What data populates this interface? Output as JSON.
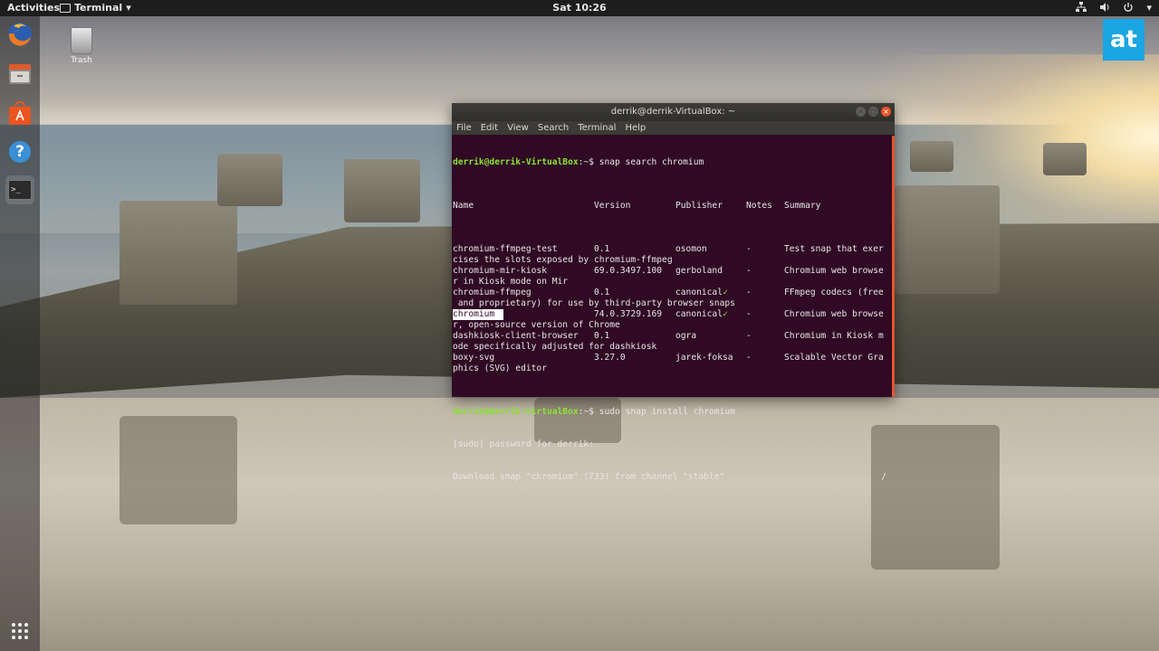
{
  "topbar": {
    "activities": "Activities",
    "app_menu": "Terminal",
    "app_menu_arrow": "▾",
    "clock": "Sat 10:26",
    "tray_icons": [
      "network-icon",
      "volume-icon",
      "power-icon"
    ],
    "tray_arrow": "▾"
  },
  "dock": {
    "items": [
      "firefox-icon",
      "files-icon",
      "software-icon",
      "help-icon",
      "terminal-icon"
    ],
    "help_glyph": "?",
    "terminal_glyph": ">_",
    "apps_glyph": "⋮⋮⋮"
  },
  "desktop": {
    "trash_label": "Trash"
  },
  "watermark": {
    "text": "at",
    "color": "#1aa5e3"
  },
  "terminal": {
    "title": "derrik@derrik-VirtualBox: ~",
    "window_buttons": {
      "minimize": "–",
      "maximize": "□",
      "close": "×"
    },
    "menu": [
      "File",
      "Edit",
      "View",
      "Search",
      "Terminal",
      "Help"
    ],
    "prompt_user": "derrik@derrik-VirtualBox",
    "prompt_suffix": ":~$ ",
    "command1": "snap search chromium",
    "headers": {
      "name": "Name",
      "version": "Version",
      "publisher": "Publisher",
      "notes": "Notes",
      "summary": "Summary"
    },
    "rows": [
      {
        "name": "chromium-ffmpeg-test",
        "version": "0.1",
        "publisher": "osomon",
        "verified": "",
        "notes": "-",
        "summary": "Test snap that exer",
        "wrap": "cises the slots exposed by chromium-ffmpeg"
      },
      {
        "name": "chromium-mir-kiosk",
        "version": "69.0.3497.100",
        "publisher": "gerboland",
        "verified": "",
        "notes": "-",
        "summary": "Chromium web browse",
        "wrap": "r in Kiosk mode on Mir"
      },
      {
        "name": "chromium-ffmpeg",
        "version": "0.1",
        "publisher": "canonical",
        "verified": "✓",
        "notes": "-",
        "summary": "FFmpeg codecs (free",
        "wrap": " and proprietary) for use by third-party browser snaps"
      },
      {
        "name": "chromium",
        "version": "74.0.3729.169",
        "publisher": "canonical",
        "verified": "✓",
        "notes": "-",
        "summary": "Chromium web browse",
        "wrap": "r, open-source version of Chrome",
        "highlight": true
      },
      {
        "name": "dashkiosk-client-browser",
        "version": "0.1",
        "publisher": "ogra",
        "verified": "",
        "notes": "-",
        "summary": "Chromium in Kiosk m",
        "wrap": "ode specifically adjusted for dashkiosk"
      },
      {
        "name": "boxy-svg",
        "version": "3.27.0",
        "publisher": "jarek-foksa",
        "verified": "",
        "notes": "-",
        "summary": "Scalable Vector Gra",
        "wrap": "phics (SVG) editor"
      }
    ],
    "command2": "sudo snap install chromium",
    "sudo_prompt": "[sudo] password for derrik:",
    "download_line": "Download snap \"chromium\" (733) from channel \"stable\"",
    "spinner": "/"
  },
  "colors": {
    "terminal_bg": "#300a24",
    "prompt": "#8ae234",
    "close_button": "#e9542a"
  }
}
